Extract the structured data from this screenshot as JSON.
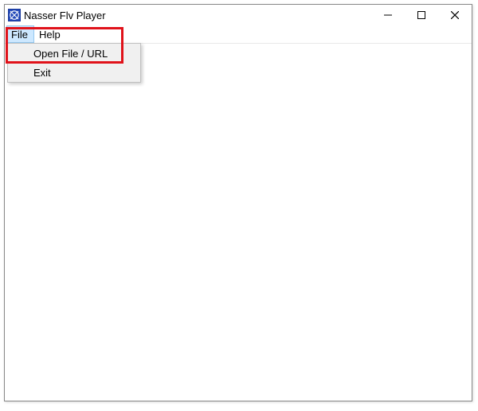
{
  "window": {
    "title": "Nasser Flv Player"
  },
  "menubar": {
    "file": "File",
    "help": "Help"
  },
  "file_menu": {
    "open": "Open File / URL",
    "exit": "Exit"
  }
}
